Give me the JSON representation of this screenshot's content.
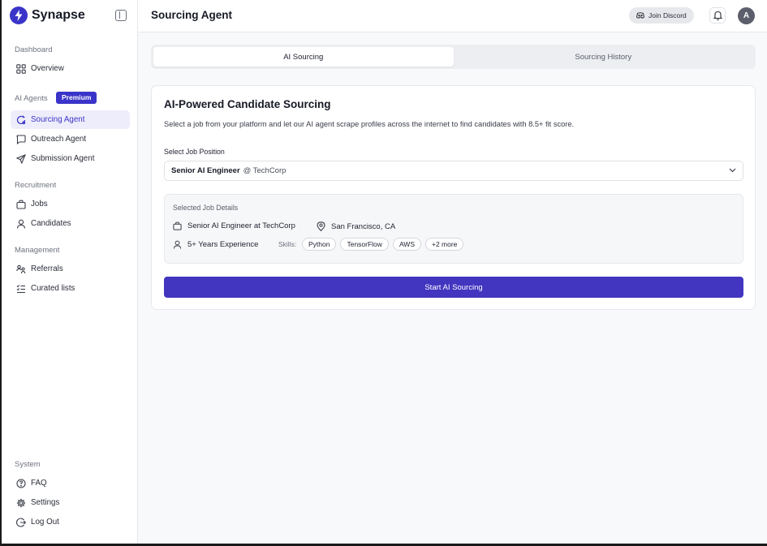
{
  "brand": {
    "name": "Synapse",
    "logo_icon": "lightning-bolt-icon"
  },
  "sidebar": {
    "sections": {
      "dashboard": "Dashboard",
      "ai_agents": "AI Agents",
      "premium_badge": "Premium",
      "recruitment": "Recruitment",
      "management": "Management",
      "system": "System"
    },
    "items": {
      "overview": "Overview",
      "sourcing_agent": "Sourcing Agent",
      "outreach_agent": "Outreach Agent",
      "submission_agent": "Submission Agent",
      "jobs": "Jobs",
      "candidates": "Candidates",
      "referrals": "Referrals",
      "curated_lists": "Curated lists",
      "faq": "FAQ",
      "settings": "Settings",
      "logout": "Log Out"
    },
    "active_item": "sourcing_agent"
  },
  "header": {
    "title": "Sourcing Agent",
    "discord_label": "Join Discord",
    "avatar_initial": "A"
  },
  "tabs": {
    "ai_sourcing": "AI Sourcing",
    "sourcing_history": "Sourcing History",
    "active": "ai_sourcing"
  },
  "card": {
    "title": "AI-Powered Candidate Sourcing",
    "description": "Select a job from your platform and let our AI agent scrape profiles across the internet to find candidates with 8.5+ fit score.",
    "field_label": "Select Job Position",
    "selected_job": {
      "title": "Senior AI Engineer",
      "company": "@ TechCorp"
    },
    "details": {
      "heading": "Selected Job Details",
      "role": "Senior AI Engineer at TechCorp",
      "location": "San Francisco, CA",
      "experience": "5+ Years Experience",
      "skills_label": "Skills:",
      "skills": [
        "Python",
        "TensorFlow",
        "AWS",
        "+2 more"
      ]
    },
    "start_button": "Start AI Sourcing"
  },
  "colors": {
    "accent": "#3a34c9",
    "button": "#4236c0",
    "active_nav_bg": "#eeedfb"
  }
}
